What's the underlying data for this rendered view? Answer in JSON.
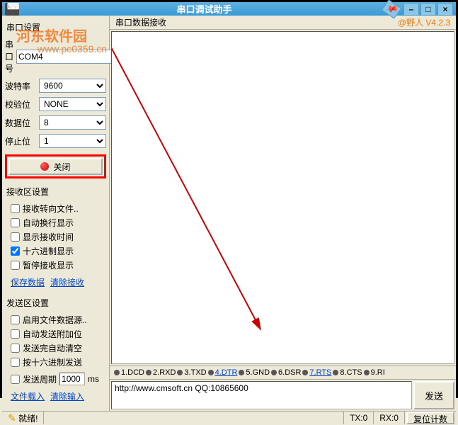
{
  "title": "串口调试助手",
  "watermark": {
    "text1": "河东软件园",
    "text2": "www.pc0359.cn"
  },
  "brand": "@野人  V4.2.3",
  "port": {
    "section": "串口设置",
    "labels": {
      "port": "串口号",
      "baud": "波特率",
      "parity": "校验位",
      "data": "数据位",
      "stop": "停止位"
    },
    "values": {
      "port": "COM4",
      "baud": "9600",
      "parity": "NONE",
      "data": "8",
      "stop": "1"
    },
    "close_label": "关闭"
  },
  "recv": {
    "section": "接收区设置",
    "items": [
      {
        "label": "接收转向文件..",
        "checked": false
      },
      {
        "label": "自动换行显示",
        "checked": false
      },
      {
        "label": "显示接收时间",
        "checked": false
      },
      {
        "label": "十六进制显示",
        "checked": true
      },
      {
        "label": "暂停接收显示",
        "checked": false
      }
    ],
    "links": {
      "save": "保存数据",
      "clear": "清除接收"
    }
  },
  "send": {
    "section": "发送区设置",
    "items": [
      {
        "label": "启用文件数据源..",
        "checked": false
      },
      {
        "label": "自动发送附加位",
        "checked": false
      },
      {
        "label": "发送完自动清空",
        "checked": false
      },
      {
        "label": "按十六进制发送",
        "checked": false
      }
    ],
    "period": {
      "label": "发送周期",
      "value": "1000",
      "unit": "ms"
    },
    "links": {
      "load": "文件载入",
      "clear": "清除输入"
    }
  },
  "right_header": "串口数据接收",
  "signals": [
    "1.DCD",
    "2.RXD",
    "3.TXD",
    "4.DTR",
    "5.GND",
    "6.DSR",
    "7.RTS",
    "8.CTS",
    "9.RI"
  ],
  "send_box": {
    "text": "http://www.cmsoft.cn QQ:10865600",
    "button": "发送"
  },
  "status": {
    "ready": "就绪!",
    "tx": "TX:0",
    "rx": "RX:0",
    "reset": "复位计数"
  }
}
